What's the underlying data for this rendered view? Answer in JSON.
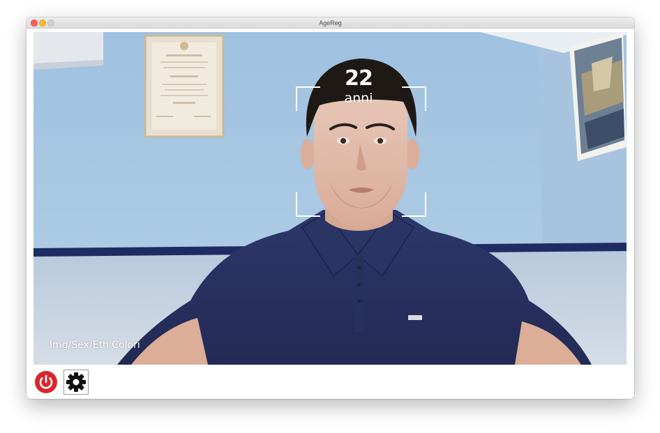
{
  "window": {
    "title": "AgeReg"
  },
  "overlay": {
    "age_value": "22",
    "age_unit": "anni",
    "mode_caption": "Img/Sex/Eth  Colori"
  },
  "toolbar": {
    "power_icon": "power-icon",
    "settings_icon": "gear-icon"
  },
  "colors": {
    "power_red": "#d9262c",
    "overlay_text": "#ffffff",
    "wall_blue": "#a9c8e2",
    "shirt_navy": "#2a3568"
  }
}
